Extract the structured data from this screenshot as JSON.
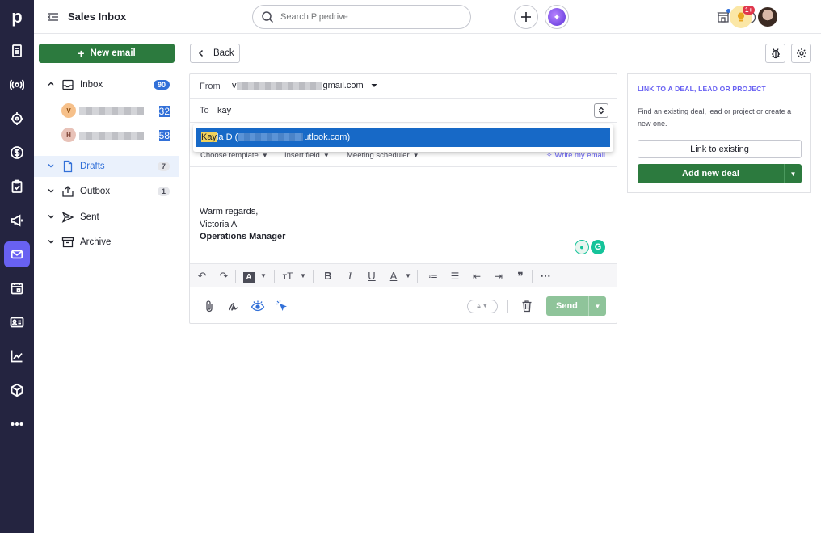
{
  "app": {
    "logo": "p",
    "title": "Sales Inbox"
  },
  "search": {
    "placeholder": "Search Pipedrive"
  },
  "notifications": {
    "badge": "1+"
  },
  "sidebar": {
    "new_email_label": "New email",
    "folders": [
      {
        "name": "Inbox",
        "count": "90"
      },
      {
        "name": "Drafts",
        "count": "7"
      },
      {
        "name": "Outbox",
        "count": "1"
      },
      {
        "name": "Sent"
      },
      {
        "name": "Archive"
      }
    ],
    "accounts": [
      {
        "initial": "V",
        "count": "32",
        "color": "#f6c08a"
      },
      {
        "initial": "H",
        "count": "58",
        "color": "#e8c2b8"
      }
    ]
  },
  "toolbar": {
    "back_label": "Back"
  },
  "composer": {
    "from_label": "From",
    "from_prefix": "v",
    "from_suffix": "gmail.com",
    "to_label": "To",
    "to_value": "kay",
    "suggestion": {
      "match": "Kay",
      "rest": "la D (",
      "email_suffix": "utlook.com)"
    },
    "tools": {
      "choose_template": "Choose template",
      "insert_field": "Insert field",
      "meeting_scheduler": "Meeting scheduler",
      "write_email": "Write my email"
    },
    "body": {
      "closing": "Warm regards,",
      "name": "Victoria A",
      "position": "Operations Manager"
    },
    "send_label": "Send"
  },
  "link_panel": {
    "title": "LINK TO A DEAL, LEAD OR PROJECT",
    "description": "Find an existing deal, lead or project or create a new one.",
    "link_existing_label": "Link to existing",
    "add_deal_label": "Add new deal"
  },
  "colors": {
    "rail": "#242440",
    "accent_green": "#2c7a3e",
    "accent_blue": "#3270d8",
    "accent_purple": "#6861f2"
  }
}
